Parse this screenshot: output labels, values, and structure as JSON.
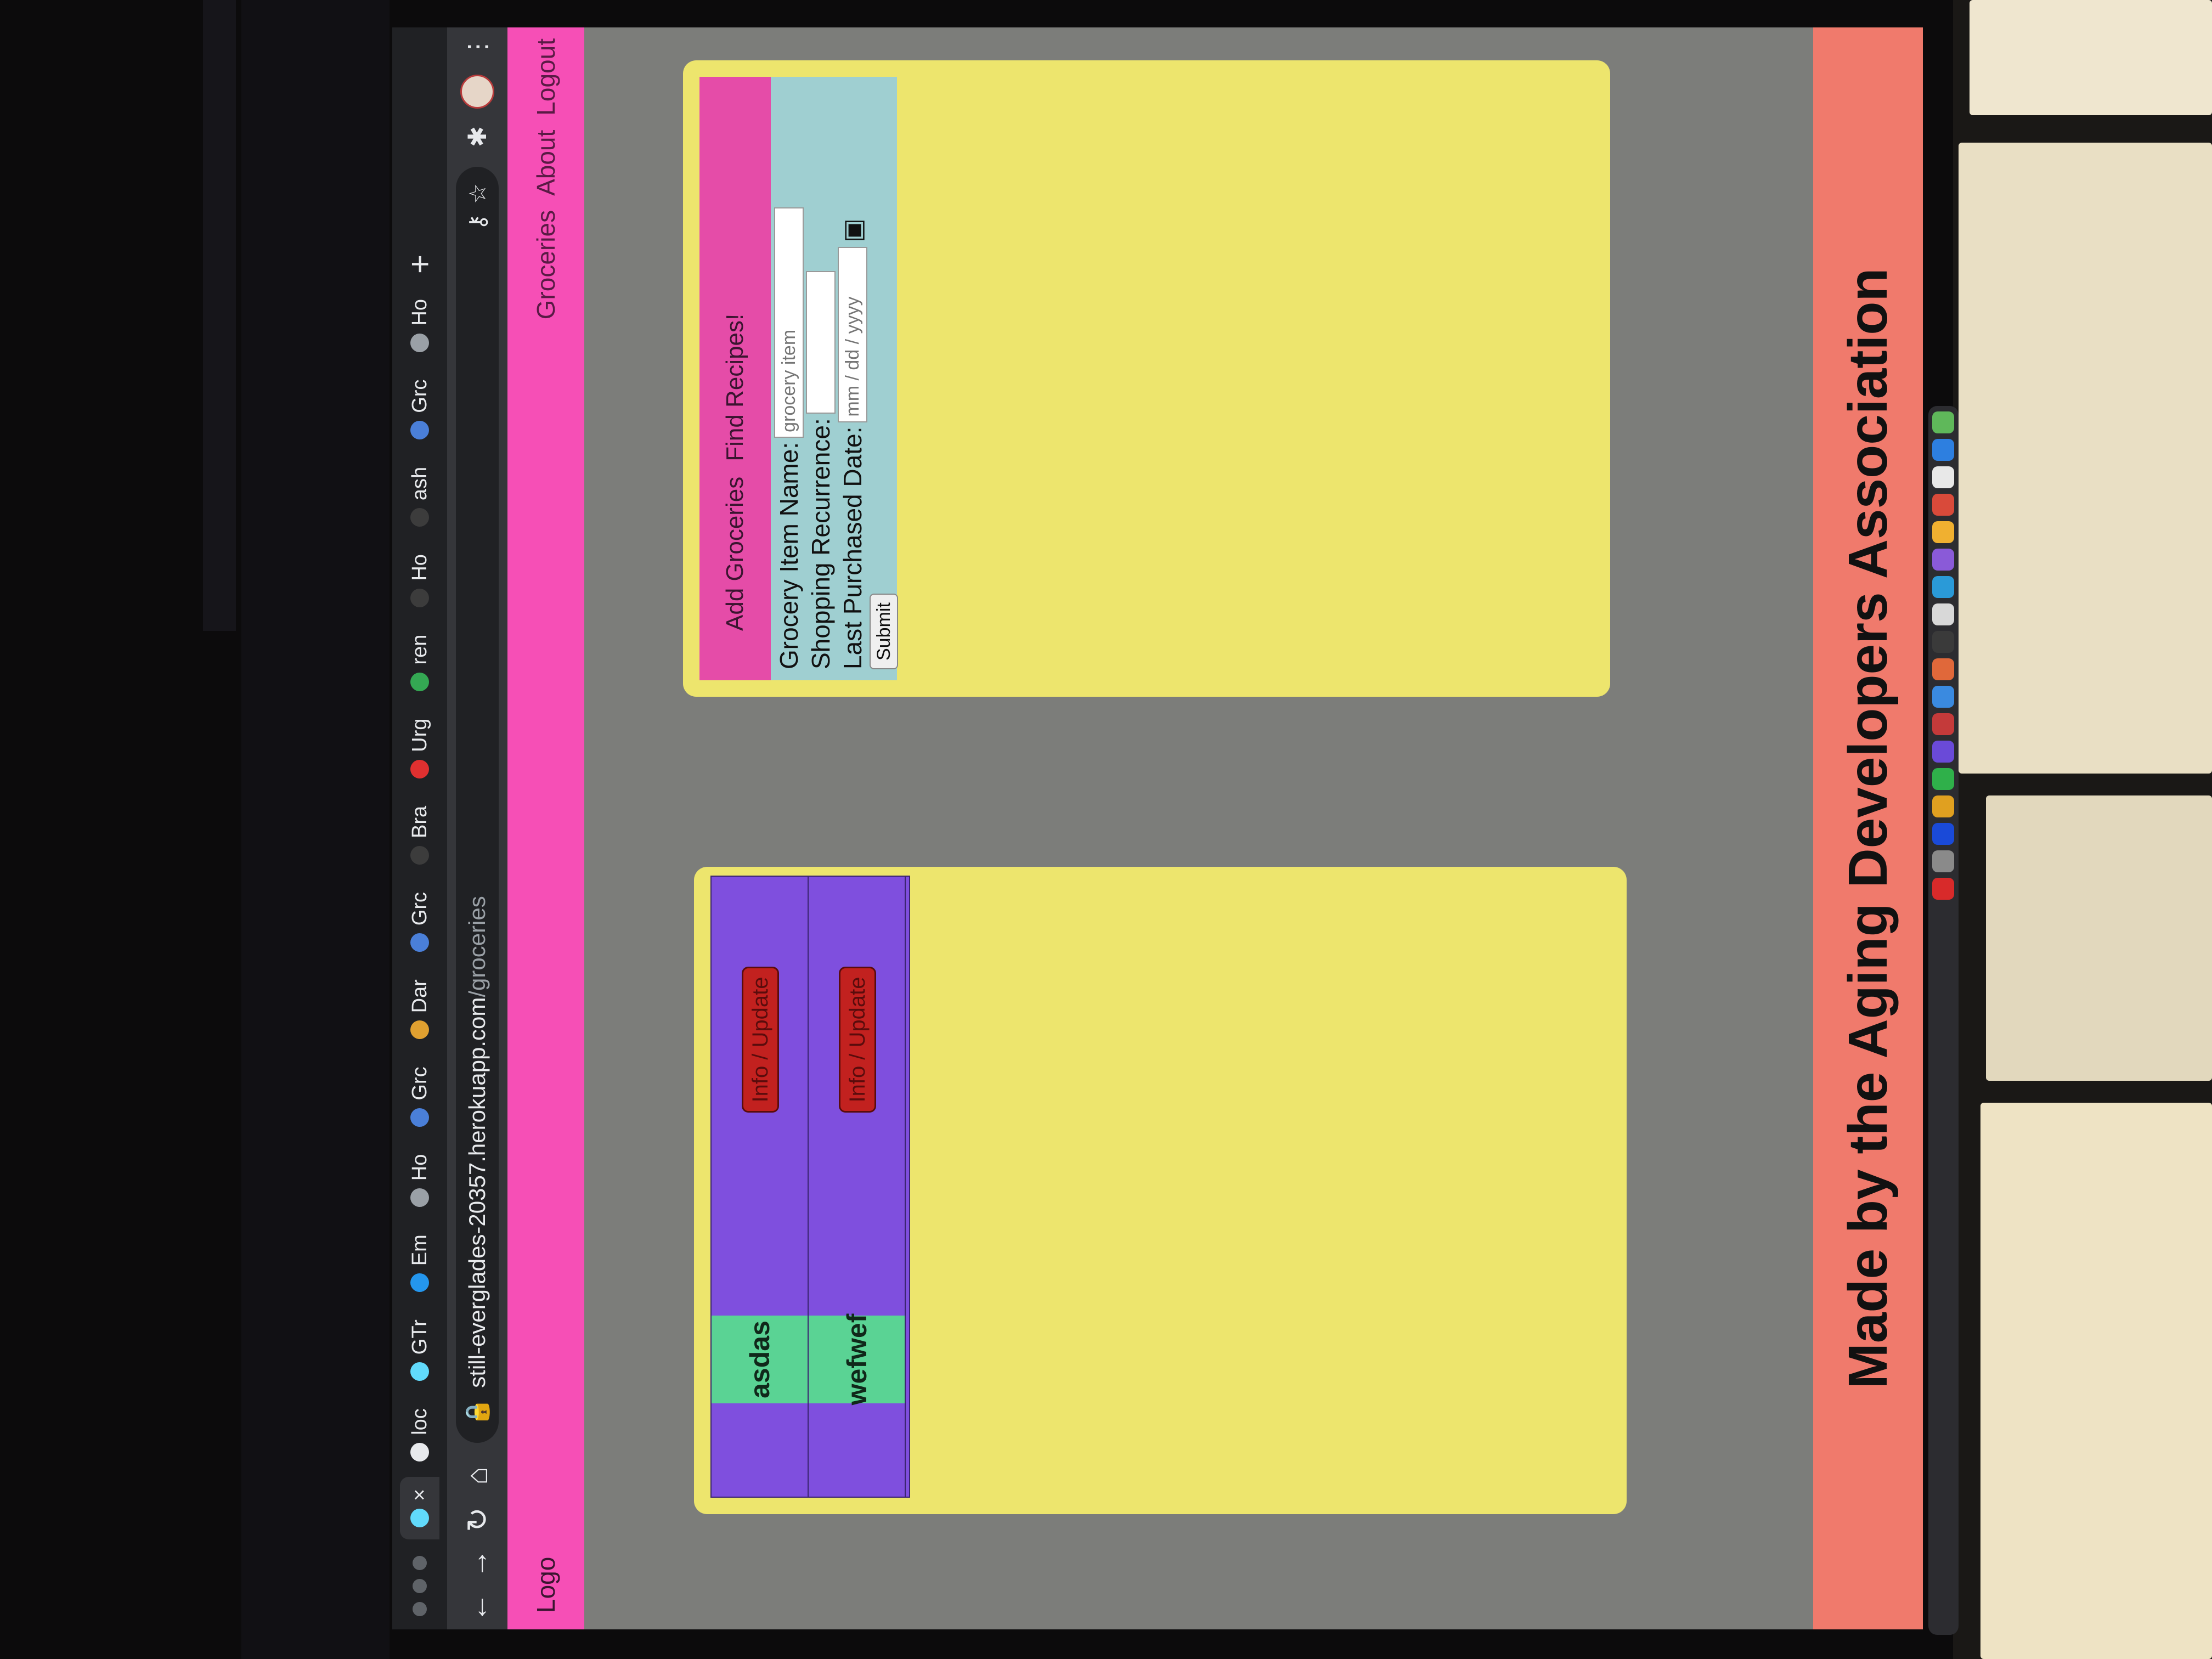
{
  "browser": {
    "tabs": [
      {
        "label": "",
        "icon": "react-icon",
        "active": true
      },
      {
        "label": "loc",
        "icon": "globe-icon"
      },
      {
        "label": "GTr",
        "icon": "react-icon"
      },
      {
        "label": "Em",
        "icon": "docker-icon"
      },
      {
        "label": "Ho",
        "icon": "openai-icon"
      },
      {
        "label": "Grc",
        "icon": "grocery-icon"
      },
      {
        "label": "Dar",
        "icon": "calendar-icon"
      },
      {
        "label": "Grc",
        "icon": "grocery-icon"
      },
      {
        "label": "Bra",
        "icon": "github-icon"
      },
      {
        "label": "Urg",
        "icon": "medical-icon"
      },
      {
        "label": "ren",
        "icon": "google-icon"
      },
      {
        "label": "Ho",
        "icon": "github-icon"
      },
      {
        "label": "ash",
        "icon": "github-icon"
      },
      {
        "label": "Grc",
        "icon": "grocery-icon"
      },
      {
        "label": "Ho",
        "icon": "openai-icon"
      }
    ],
    "close_tab": "×",
    "new_tab": "+",
    "url_host": "still-everglades-20357.herokuapp.com",
    "url_path": "/groceries",
    "menu": "⋮"
  },
  "navbar": {
    "logo": "Logo",
    "links": [
      "Groceries",
      "About",
      "Logout"
    ]
  },
  "groceries": [
    {
      "name": "asdas",
      "button": "Info / Update"
    },
    {
      "name": "wefwef",
      "button": "Info / Update"
    }
  ],
  "form": {
    "tabs": [
      "Add Groceries",
      "Find Recipes!"
    ],
    "item_label": "Grocery Item Name:",
    "item_placeholder": "grocery item",
    "recurrence_label": "Shopping Recurrence:",
    "date_label": "Last Purchased Date:",
    "date_placeholder": "mm / dd / yyyy",
    "submit": "Submit"
  },
  "footer": {
    "text": "Made by the Aging Developers Association"
  },
  "colors": {
    "navbar": "#f64fb6",
    "card": "#ede56d",
    "table": "#7f4fde",
    "name_cell": "#5ad394",
    "button": "#c2211f",
    "footer": "#f07a6c"
  }
}
